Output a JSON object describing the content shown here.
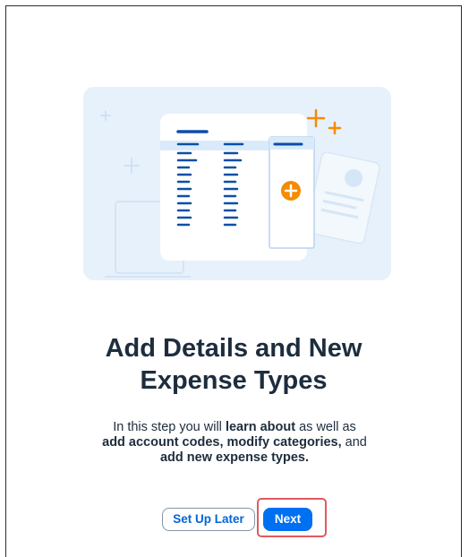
{
  "dialog": {
    "title_line1": "Add Details and New",
    "title_line2": "Expense Types",
    "description": {
      "part1": "In this step you will ",
      "part2_bold": "learn about",
      "part3": " as well as",
      "part4_bold": "add account codes, modify categories,",
      "part5": " and",
      "part6_bold": "add new expense types."
    },
    "buttons": {
      "secondary_label": "Set Up Later",
      "primary_label": "Next"
    }
  },
  "illustration": {
    "icon": "expense-list-illustration",
    "accent_blue": "#0a6ed1",
    "accent_orange": "#f58b00",
    "background": "#e5f0fa"
  },
  "colors": {
    "primary_button": "#0070f2",
    "secondary_button_text": "#0064d9",
    "highlight_border": "#e05a5f",
    "text": "#1d2d3e"
  }
}
